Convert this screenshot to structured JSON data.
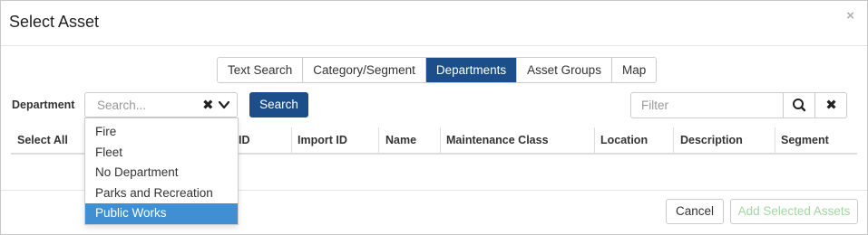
{
  "modal": {
    "title": "Select Asset",
    "close_glyph": "×"
  },
  "tabs": [
    {
      "label": "Text Search",
      "active": false
    },
    {
      "label": "Category/Segment",
      "active": false
    },
    {
      "label": "Departments",
      "active": true
    },
    {
      "label": "Asset Groups",
      "active": false
    },
    {
      "label": "Map",
      "active": false
    }
  ],
  "department": {
    "label": "Department",
    "placeholder": "Search...",
    "clear_icon": "close-icon",
    "toggle_icon": "chevron-down-icon",
    "options": [
      "Fire",
      "Fleet",
      "No Department",
      "Parks and Recreation",
      "Public Works"
    ],
    "highlighted": "Public Works"
  },
  "search_button": "Search",
  "filter": {
    "placeholder": "Filter",
    "search_icon": "search-icon",
    "clear_icon": "close-icon"
  },
  "table": {
    "columns": [
      "Select All",
      "ID",
      "Import ID",
      "Name",
      "Maintenance Class",
      "Location",
      "Description",
      "Segment"
    ]
  },
  "footer": {
    "cancel": "Cancel",
    "add": "Add Selected Assets"
  },
  "colors": {
    "primary": "#1c4f8a",
    "highlight": "#3f8fd2",
    "disabled_text": "#a3d6a3"
  }
}
